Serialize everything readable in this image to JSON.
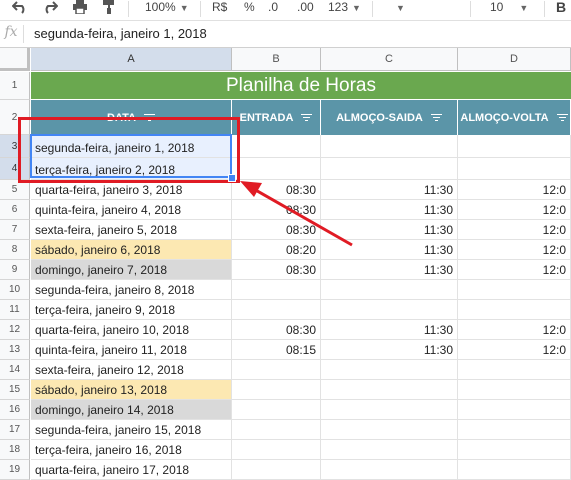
{
  "toolbar": {
    "undo_icon": "undo-icon",
    "redo_icon": "redo-icon",
    "print_icon": "print-icon",
    "paint_format_icon": "paint-format-icon",
    "zoom": "100%",
    "currency": "R$",
    "percent": "%",
    "dec_decrease": ".0",
    "dec_increase": ".00",
    "more_formats": "123",
    "font_size": "10",
    "bold": "B"
  },
  "formula_bar": {
    "fx_label": "fx",
    "value": "segunda-feira, janeiro 1, 2018"
  },
  "column_headers": [
    "A",
    "B",
    "C",
    "D"
  ],
  "row_numbers": [
    "1",
    "2",
    "3",
    "4",
    "5",
    "6",
    "7",
    "8",
    "9",
    "10",
    "11",
    "12",
    "13",
    "14",
    "15",
    "16",
    "17",
    "18",
    "19"
  ],
  "sheet": {
    "title": "Planilha de Horas",
    "header_color": "#5b95a8",
    "title_color": "#6aa84f",
    "headers": [
      "DATA",
      "ENTRADA",
      "ALMOÇO-SAIDA",
      "ALMOÇO-VOLTA"
    ],
    "rows": [
      {
        "date": "segunda-feira, janeiro 1, 2018",
        "entrada": "",
        "saida": "",
        "volta": "",
        "kind": "selected"
      },
      {
        "date": "terça-feira, janeiro 2, 2018",
        "entrada": "",
        "saida": "",
        "volta": "",
        "kind": "selected"
      },
      {
        "date": "quarta-feira, janeiro 3, 2018",
        "entrada": "08:30",
        "saida": "11:30",
        "volta": "12:0",
        "kind": "normal"
      },
      {
        "date": "quinta-feira, janeiro 4, 2018",
        "entrada": "08:30",
        "saida": "11:30",
        "volta": "12:0",
        "kind": "normal"
      },
      {
        "date": "sexta-feira, janeiro 5, 2018",
        "entrada": "08:30",
        "saida": "11:30",
        "volta": "12:0",
        "kind": "normal"
      },
      {
        "date": "sábado, janeiro 6, 2018",
        "entrada": "08:20",
        "saida": "11:30",
        "volta": "12:0",
        "kind": "sat"
      },
      {
        "date": "domingo, janeiro 7, 2018",
        "entrada": "08:30",
        "saida": "11:30",
        "volta": "12:0",
        "kind": "sun"
      },
      {
        "date": "segunda-feira, janeiro 8, 2018",
        "entrada": "",
        "saida": "",
        "volta": "",
        "kind": "normal"
      },
      {
        "date": "terça-feira, janeiro 9, 2018",
        "entrada": "",
        "saida": "",
        "volta": "",
        "kind": "normal"
      },
      {
        "date": "quarta-feira, janeiro 10, 2018",
        "entrada": "08:30",
        "saida": "11:30",
        "volta": "12:0",
        "kind": "normal"
      },
      {
        "date": "quinta-feira, janeiro 11, 2018",
        "entrada": "08:15",
        "saida": "11:30",
        "volta": "12:0",
        "kind": "normal"
      },
      {
        "date": "sexta-feira, janeiro 12, 2018",
        "entrada": "",
        "saida": "",
        "volta": "",
        "kind": "normal"
      },
      {
        "date": "sábado, janeiro 13, 2018",
        "entrada": "",
        "saida": "",
        "volta": "",
        "kind": "sat"
      },
      {
        "date": "domingo, janeiro 14, 2018",
        "entrada": "",
        "saida": "",
        "volta": "",
        "kind": "sun"
      },
      {
        "date": "segunda-feira, janeiro 15, 2018",
        "entrada": "",
        "saida": "",
        "volta": "",
        "kind": "normal"
      },
      {
        "date": "terça-feira, janeiro 16, 2018",
        "entrada": "",
        "saida": "",
        "volta": "",
        "kind": "normal"
      },
      {
        "date": "quarta-feira, janeiro 17, 2018",
        "entrada": "",
        "saida": "",
        "volta": "",
        "kind": "normal"
      }
    ]
  }
}
